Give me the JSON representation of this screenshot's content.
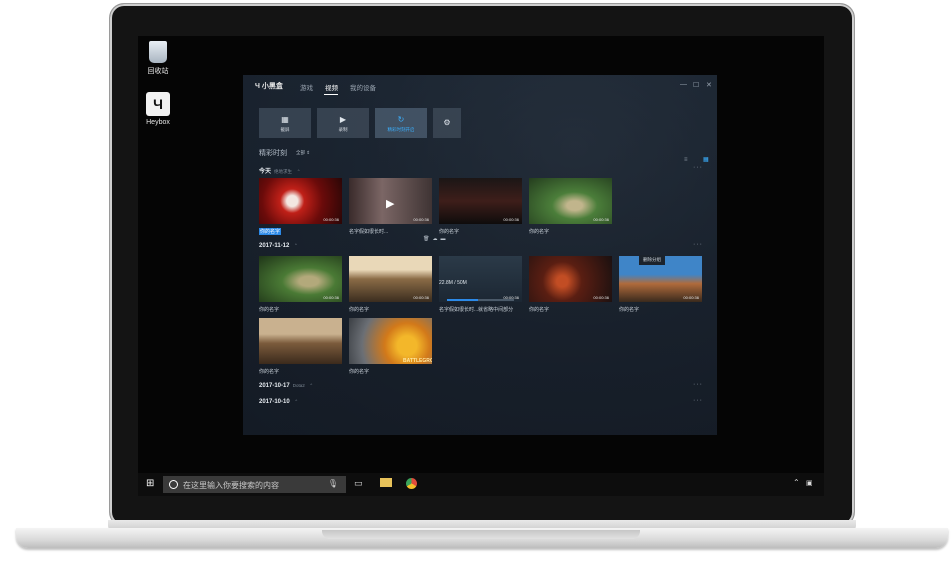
{
  "desktop": {
    "icons": [
      {
        "label": "回收站",
        "icon": "recycle-bin-icon"
      },
      {
        "label": "Heybox",
        "icon": "heybox-icon"
      }
    ]
  },
  "app": {
    "brand": "小黑盒",
    "nav": [
      "游戏",
      "视频",
      "我的设备"
    ],
    "active_nav": "视频",
    "window_controls": [
      "—",
      "☐",
      "✕"
    ],
    "toolbar": [
      {
        "label": "截屏",
        "icon": "screenshot-icon"
      },
      {
        "label": "录制",
        "icon": "record-icon"
      },
      {
        "label": "精彩时刻开启",
        "icon": "highlight-icon"
      },
      {
        "label": "",
        "icon": "gear-icon"
      }
    ],
    "section": {
      "title": "精彩时刻",
      "filter": "全部 ⇕"
    },
    "groups": [
      {
        "date": "今天",
        "sub": "绝地求生",
        "items": [
          {
            "caption": "你的名字",
            "duration": "00:00:36",
            "selected": true
          },
          {
            "caption": "名字假如很长时...",
            "duration": "00:00:36",
            "selected": false
          },
          {
            "caption": "你的名字",
            "duration": "00:00:36",
            "selected": false
          },
          {
            "caption": "你的名字",
            "duration": "00:00:36",
            "selected": false
          }
        ]
      },
      {
        "date": "2017-11-12",
        "sub": "",
        "items": [
          {
            "caption": "你的名字",
            "duration": "00:00:36"
          },
          {
            "caption": "你的名字",
            "duration": "00:00:36"
          },
          {
            "caption": "名字假如很长时...就省略中间部分",
            "duration": "00:00:36",
            "progress_text": "22.8M / 50M",
            "progress": 0.46
          },
          {
            "caption": "你的名字",
            "duration": "00:00:36"
          },
          {
            "caption": "你的名字",
            "duration": "00:00:36"
          },
          {
            "caption": "你的名字",
            "duration": ""
          },
          {
            "caption": "你的名字",
            "duration": ""
          }
        ]
      },
      {
        "date": "2017-10-17",
        "sub": "Dota2",
        "items": []
      },
      {
        "date": "2017-10-10",
        "sub": "",
        "items": []
      }
    ],
    "tooltip": "删除分组",
    "more": "···"
  },
  "taskbar": {
    "search_placeholder": "在这里输入你要搜索的内容"
  },
  "colors": {
    "accent": "#2c8ae8",
    "upload": "#3bb0ff"
  }
}
